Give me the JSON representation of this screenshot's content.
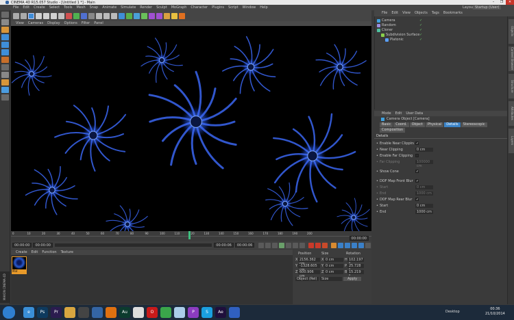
{
  "window": {
    "title": "CINEMA 4D R15.057 Studio - [Untitled 1 *] - Main",
    "controls": [
      "–",
      "❐",
      "✕"
    ]
  },
  "menu": {
    "items": [
      "File",
      "Edit",
      "Create",
      "Select",
      "Tools",
      "Mesh",
      "Snap",
      "Animate",
      "Simulate",
      "Render",
      "Sculpt",
      "MoGraph",
      "Character",
      "Plugins",
      "Script",
      "Window",
      "Help"
    ],
    "layout_label": "Layout:",
    "layout_value": "Startup (User)"
  },
  "viewport": {
    "menu": [
      "View",
      "Cameras",
      "Display",
      "Options",
      "Filter",
      "Panel"
    ]
  },
  "timeline": {
    "ticks": [
      "0",
      "10",
      "20",
      "30",
      "40",
      "50",
      "60",
      "70",
      "80",
      "90",
      "100",
      "110",
      "120",
      "130",
      "140",
      "150",
      "160",
      "170",
      "180",
      "190",
      "200"
    ],
    "current_frame": "00:00:00",
    "start": "00:00:00",
    "end": "00:00:06",
    "preview_end": "00:00:06"
  },
  "materials": {
    "menu": [
      "Create",
      "Edit",
      "Function",
      "Texture"
    ],
    "items": [
      {
        "name": "Mat"
      }
    ]
  },
  "coords": {
    "headers": [
      "Position",
      "Size",
      "Rotation"
    ],
    "rows": [
      {
        "axis": "X",
        "pos": "2156.362 cm",
        "size": "0 cm",
        "rot_axis": "H",
        "rot": "102.197 °"
      },
      {
        "axis": "Y",
        "pos": "-1328.605 cm",
        "size": "0 cm",
        "rot_axis": "P",
        "rot": "25.728 °"
      },
      {
        "axis": "Z",
        "pos": "600.906 cm",
        "size": "0 cm",
        "rot_axis": "B",
        "rot": "15.219 °"
      }
    ],
    "mode": "Object (Rel)",
    "size_mode": "Size",
    "apply": "Apply"
  },
  "object_manager": {
    "menu": [
      "File",
      "Edit",
      "View",
      "Objects",
      "Tags",
      "Bookmarks"
    ],
    "objects": [
      {
        "name": "Camera",
        "color": "#3fa1e0",
        "indent": 0
      },
      {
        "name": "Random",
        "color": "#9a8fe0",
        "indent": 0
      },
      {
        "name": "Cloner",
        "color": "#4fc0a0",
        "indent": 0
      },
      {
        "name": "Subdivision Surface",
        "color": "#8ad04a",
        "indent": 1
      },
      {
        "name": "Platonic",
        "color": "#5aa0ff",
        "indent": 2
      }
    ]
  },
  "attributes": {
    "menu": [
      "Mode",
      "Edit",
      "User Data"
    ],
    "title": "Camera Object [Camera]",
    "tabs": [
      {
        "label": "Basic",
        "active": false
      },
      {
        "label": "Coord.",
        "active": false
      },
      {
        "label": "Object",
        "active": false
      },
      {
        "label": "Physical",
        "active": false
      },
      {
        "label": "Details",
        "active": true
      },
      {
        "label": "Stereoscopic",
        "active": false
      },
      {
        "label": "Composition",
        "active": false
      }
    ],
    "section": "Details",
    "rows": [
      {
        "label": "Enable Near Clipping",
        "type": "check",
        "value": "✓",
        "dim": false
      },
      {
        "label": "Near Clipping",
        "type": "value",
        "value": "0 cm",
        "dim": false
      },
      {
        "label": "Enable Far Clipping",
        "type": "check",
        "value": "",
        "dim": false
      },
      {
        "label": "Far Clipping",
        "type": "value",
        "value": "100000 cm",
        "dim": true
      },
      {
        "label": "",
        "type": "spacer",
        "value": "",
        "dim": false
      },
      {
        "label": "Show Cone",
        "type": "check",
        "value": "✓",
        "dim": false
      },
      {
        "label": "",
        "type": "spacer",
        "value": "",
        "dim": false
      },
      {
        "label": "DOF Map Front Blur",
        "type": "check",
        "value": "✓",
        "dim": false
      },
      {
        "label": "Start",
        "type": "value",
        "value": "0 cm",
        "dim": true
      },
      {
        "label": "End",
        "type": "value",
        "value": "1000 cm",
        "dim": true
      },
      {
        "label": "DOF Map Rear Blur",
        "type": "check",
        "value": "✓",
        "dim": false
      },
      {
        "label": "Start",
        "type": "value",
        "value": "0 cm",
        "dim": false
      },
      {
        "label": "End",
        "type": "value",
        "value": "1000 cm",
        "dim": false
      }
    ]
  },
  "right_tabs": [
    "Objects",
    "Content Browser",
    "Structure",
    "Attributes",
    "Layers"
  ],
  "maxon_logo": "MAXON CINEMA 4D",
  "taskbar": {
    "apps": [
      {
        "name": "windows-start",
        "color": "#2f7fd0",
        "label": ""
      },
      {
        "name": "internet-explorer",
        "color": "#3a8fd8",
        "label": "e"
      },
      {
        "name": "photoshop",
        "color": "#0e3a5e",
        "label": "Ps"
      },
      {
        "name": "premiere",
        "color": "#2b1c4f",
        "label": "Pr"
      },
      {
        "name": "folder",
        "color": "#d8a640",
        "label": ""
      },
      {
        "name": "media",
        "color": "#444",
        "label": ""
      },
      {
        "name": "cinema4d",
        "color": "#3465a4",
        "label": ""
      },
      {
        "name": "app-orange",
        "color": "#e07010",
        "label": ""
      },
      {
        "name": "audition",
        "color": "#0c3b2e",
        "label": "Au"
      },
      {
        "name": "app-white",
        "color": "#ddd",
        "label": ""
      },
      {
        "name": "opera",
        "color": "#c81a1a",
        "label": "O"
      },
      {
        "name": "chrome",
        "color": "#3aa64a",
        "label": ""
      },
      {
        "name": "app-lightblue",
        "color": "#aacde8",
        "label": ""
      },
      {
        "name": "app-purple",
        "color": "#8c3cc0",
        "label": "P"
      },
      {
        "name": "skype",
        "color": "#1aa0e0",
        "label": "S"
      },
      {
        "name": "after-effects",
        "color": "#1f0f3c",
        "label": "Ae"
      },
      {
        "name": "app-blue",
        "color": "#3060c0",
        "label": ""
      }
    ],
    "desktop": "Desktop",
    "time": "00:36",
    "date": "21/10/2014"
  }
}
